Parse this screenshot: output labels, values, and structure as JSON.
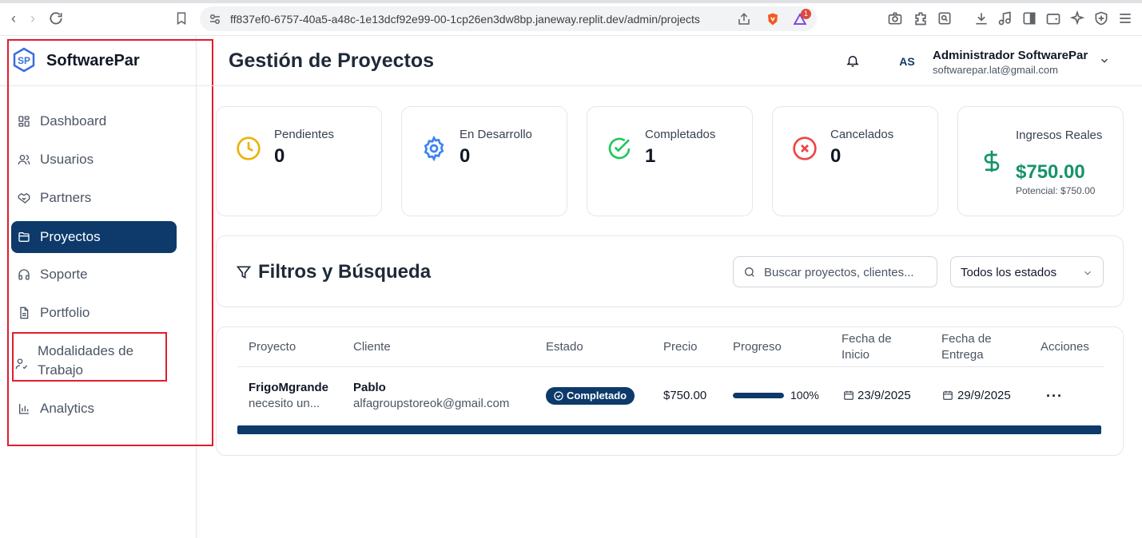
{
  "browser": {
    "url": "ff837ef0-6757-40a5-a48c-1e13dcf92e99-00-1cp26en3dw8bp.janeway.replit.dev/admin/projects",
    "notification_count": "1"
  },
  "sidebar": {
    "brand": "SoftwarePar",
    "items": [
      {
        "label": "Dashboard",
        "icon": "dashboard-icon",
        "active": false
      },
      {
        "label": "Usuarios",
        "icon": "users-icon",
        "active": false
      },
      {
        "label": "Partners",
        "icon": "handshake-icon",
        "active": false
      },
      {
        "label": "Proyectos",
        "icon": "folder-icon",
        "active": true
      },
      {
        "label": "Soporte",
        "icon": "headphones-icon",
        "active": false
      },
      {
        "label": "Portfolio",
        "icon": "document-icon",
        "active": false
      },
      {
        "label": "Modalidades de Trabajo",
        "icon": "user-check-icon",
        "active": false
      },
      {
        "label": "Analytics",
        "icon": "bar-chart-icon",
        "active": false
      }
    ]
  },
  "header": {
    "title": "Gestión de Proyectos",
    "avatar_initials": "AS",
    "user_name": "Administrador SoftwarePar",
    "user_email": "softwarepar.lat@gmail.com"
  },
  "stats": [
    {
      "label": "Pendientes",
      "value": "0",
      "icon": "clock-icon",
      "color": "#eab308"
    },
    {
      "label": "En Desarrollo",
      "value": "0",
      "icon": "gear-icon",
      "color": "#3b82f6"
    },
    {
      "label": "Completados",
      "value": "1",
      "icon": "check-circle-icon",
      "color": "#22c55e"
    },
    {
      "label": "Cancelados",
      "value": "0",
      "icon": "x-circle-icon",
      "color": "#ef4444"
    },
    {
      "label": "Ingresos Reales",
      "value": "$750.00",
      "sub": "Potencial: $750.00",
      "icon": "dollar-icon",
      "color": "#15936b"
    }
  ],
  "filters": {
    "title": "Filtros y Búsqueda",
    "search_placeholder": "Buscar proyectos, clientes...",
    "status_value": "Todos los estados"
  },
  "table": {
    "headers": [
      "Proyecto",
      "Cliente",
      "Estado",
      "Precio",
      "Progreso",
      "Fecha de Inicio",
      "Fecha de Entrega",
      "Acciones"
    ],
    "rows": [
      {
        "project": "FrigoMgrande",
        "project_desc": "necesito un...",
        "client_name": "Pablo",
        "client_email": "alfagroupstoreok@gmail.com",
        "status": "Completado",
        "price": "$750.00",
        "progress_label": "100%",
        "progress": 100,
        "start_date": "23/9/2025",
        "end_date": "29/9/2025",
        "actions": "···"
      }
    ]
  },
  "colors": {
    "primary": "#0d3a6b",
    "highlight_box": "#e11d2e"
  }
}
